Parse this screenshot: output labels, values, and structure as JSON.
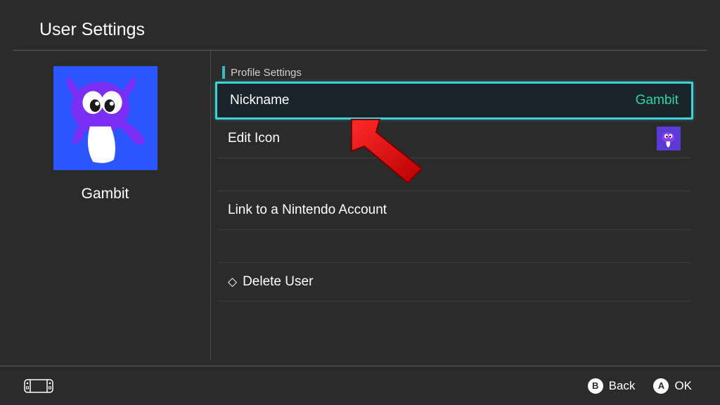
{
  "header": {
    "title": "User Settings"
  },
  "profile": {
    "username": "Gambit"
  },
  "section": {
    "title": "Profile Settings"
  },
  "rows": {
    "nickname": {
      "label": "Nickname",
      "value": "Gambit"
    },
    "editIcon": {
      "label": "Edit Icon"
    },
    "linkAccount": {
      "label": "Link to a Nintendo Account"
    },
    "deleteUser": {
      "label": "Delete User"
    }
  },
  "footer": {
    "back": {
      "key": "B",
      "label": "Back"
    },
    "ok": {
      "key": "A",
      "label": "OK"
    }
  }
}
